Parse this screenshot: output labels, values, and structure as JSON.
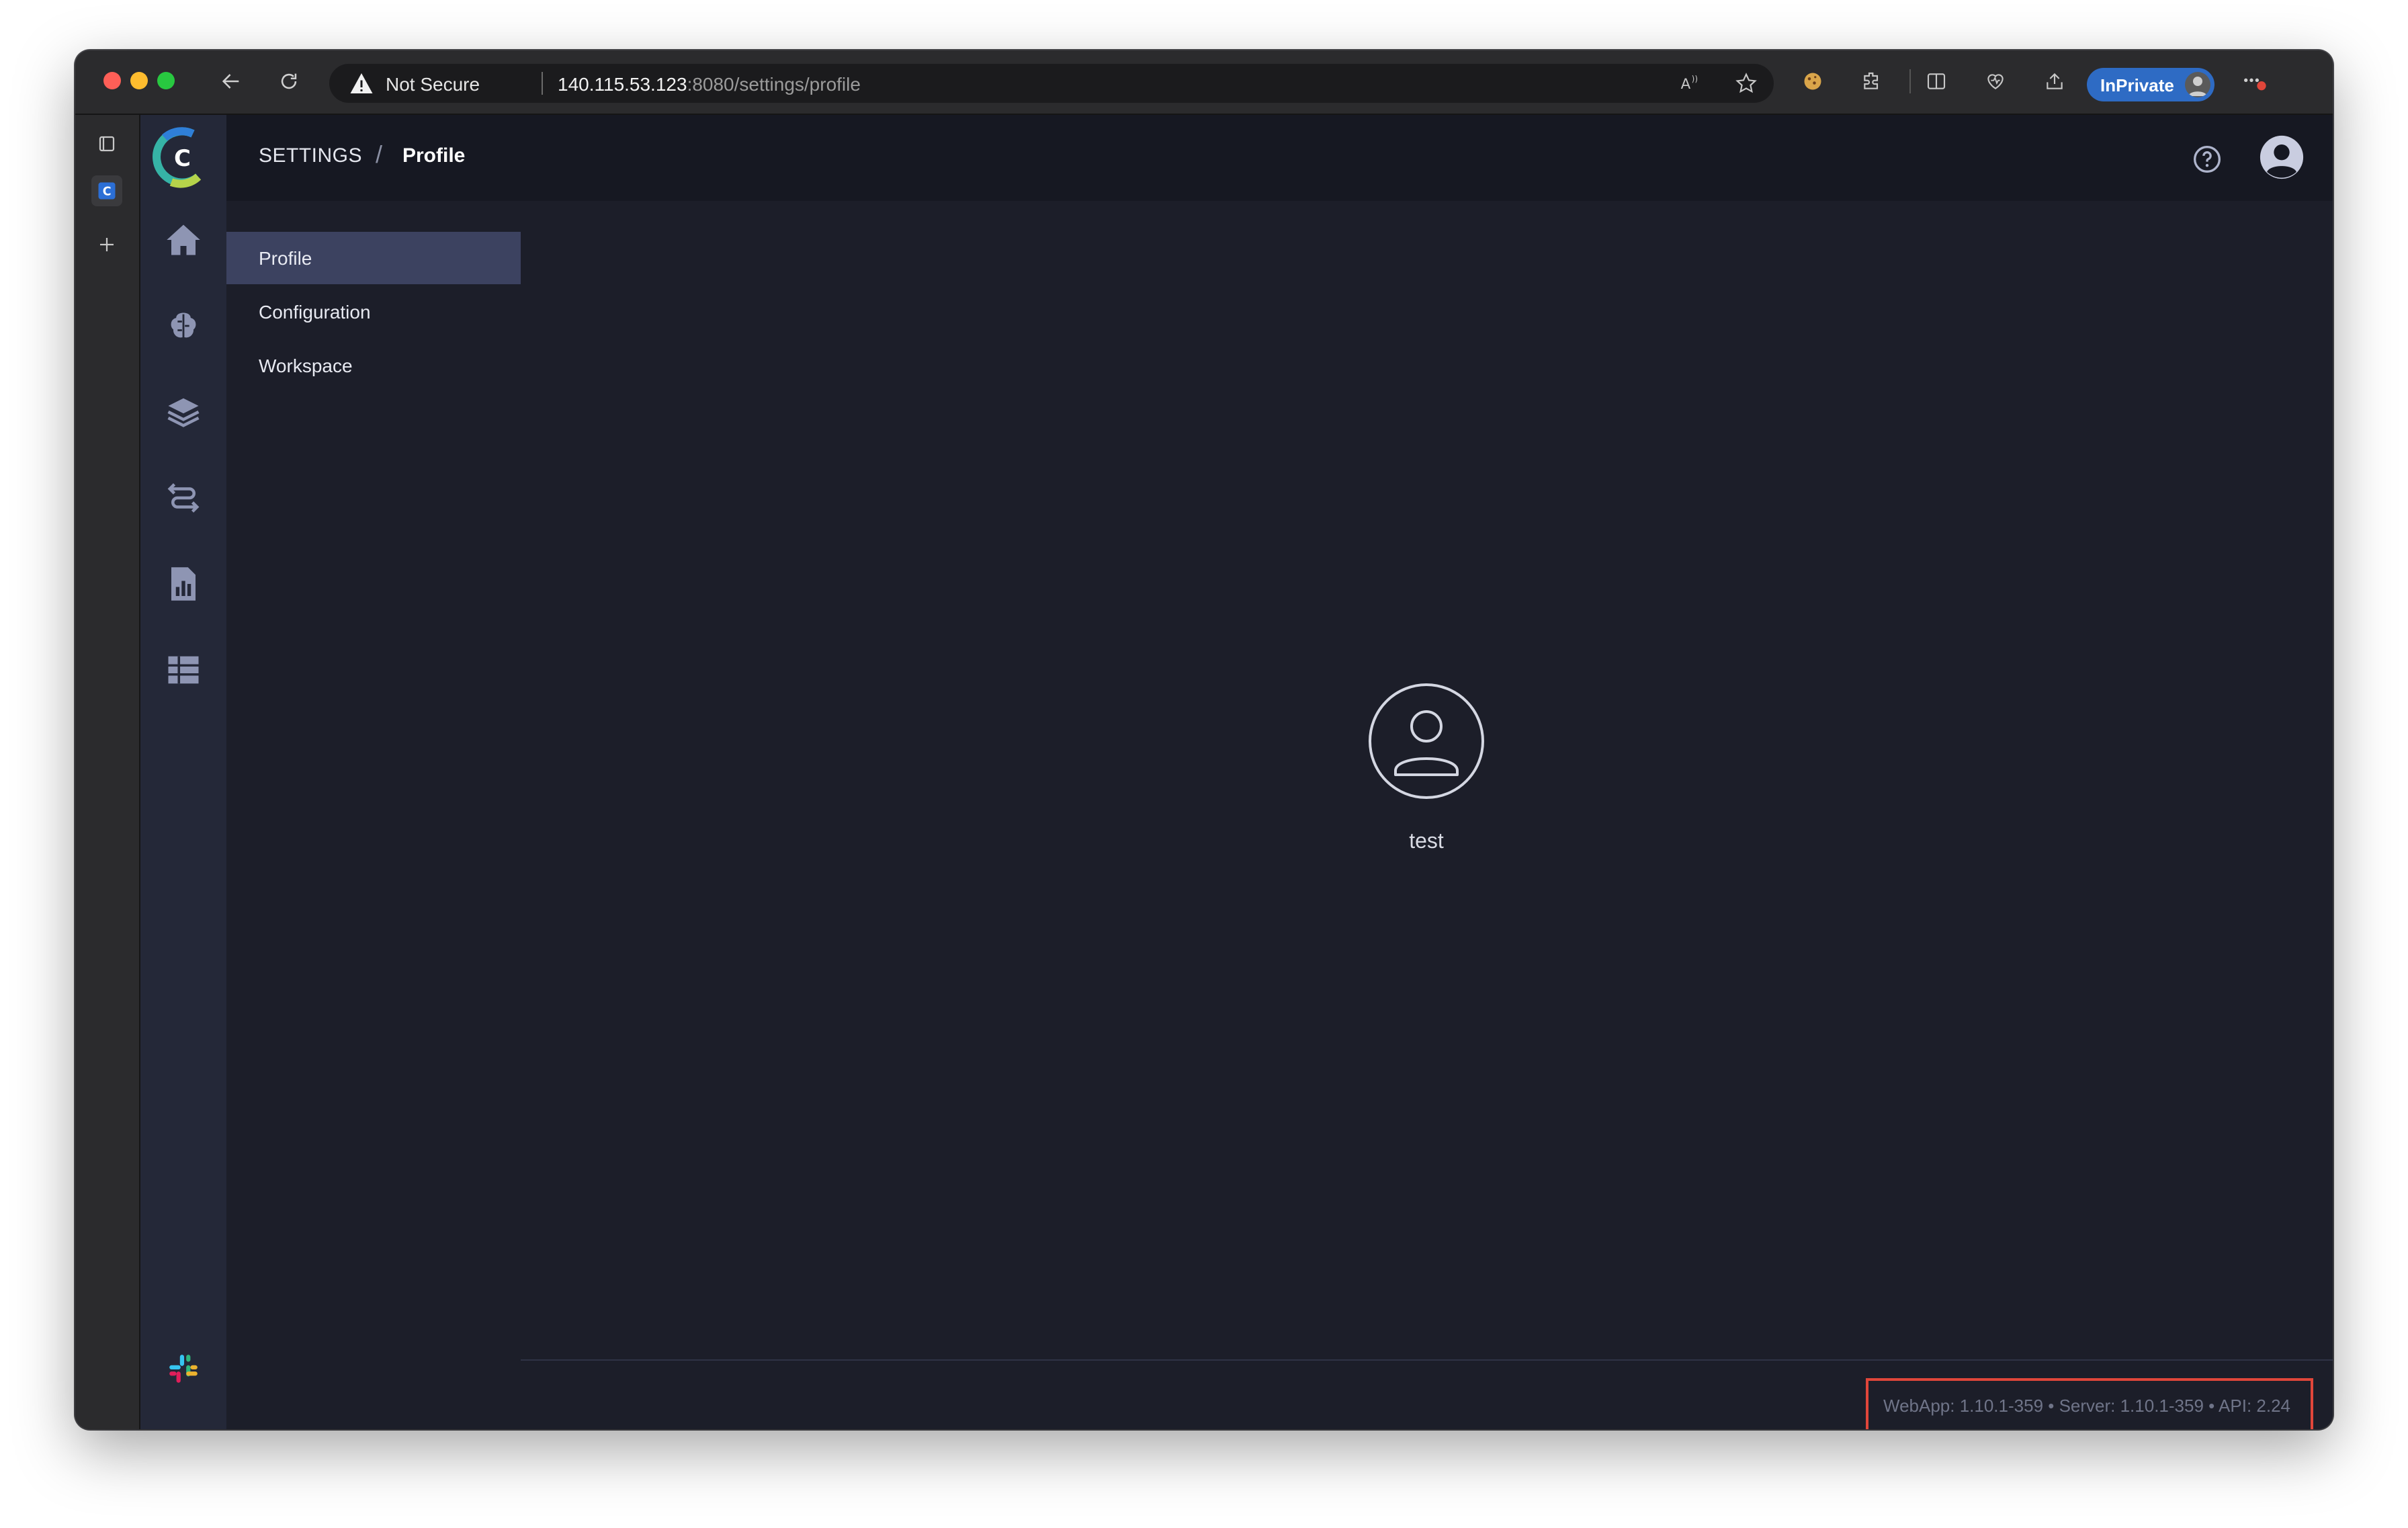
{
  "browser": {
    "address": {
      "security_label": "Not Secure",
      "host": "140.115.53.123",
      "path": ":8080/settings/profile"
    },
    "inprivate_label": "InPrivate",
    "icons": [
      "back-icon",
      "reload-icon",
      "warning-icon",
      "read-aloud-icon",
      "favorite-star-icon",
      "cookie-extension-icon",
      "extensions-icon",
      "split-screen-icon",
      "browser-essentials-icon",
      "share-icon",
      "more-options-icon",
      "tab-actions-icon",
      "add-tab-icon"
    ]
  },
  "app": {
    "breadcrumb": {
      "section": "SETTINGS",
      "separator": "/",
      "current": "Profile"
    },
    "rail_icons": [
      "home-icon",
      "brain-icon",
      "layers-icon",
      "pipelines-icon",
      "reports-icon",
      "datasets-icon",
      "slack-icon"
    ],
    "settings_menu": [
      {
        "label": "Profile",
        "active": true
      },
      {
        "label": "Configuration",
        "active": false
      },
      {
        "label": "Workspace",
        "active": false
      }
    ],
    "profile": {
      "username": "test"
    },
    "footer": {
      "version": "WebApp: 1.10.1-359 • Server: 1.10.1-359 • API: 2.24"
    }
  },
  "colors": {
    "accent_active": "#3c4260",
    "rail_bg": "#242838",
    "content_bg": "#1c1e29",
    "highlight_box": "#e0463a",
    "inprivate_badge": "#2e6bc4"
  }
}
